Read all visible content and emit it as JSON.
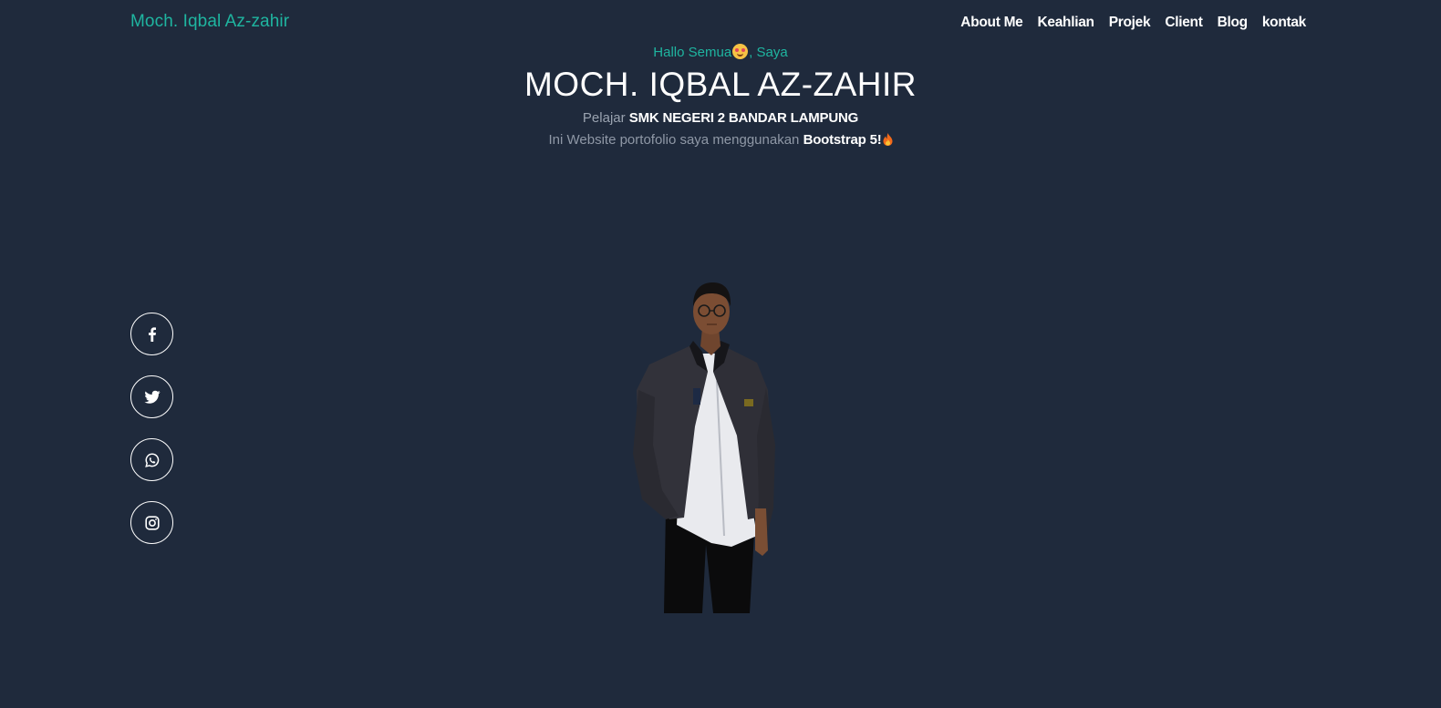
{
  "navbar": {
    "brand": "Moch. Iqbal Az-zahir",
    "links": [
      "About Me",
      "Keahlian",
      "Projek",
      "Client",
      "Blog",
      "kontak"
    ]
  },
  "hero": {
    "greeting_before": "Hallo Semua",
    "greeting_after": ", Saya",
    "name": "MOCH. IQBAL AZ-ZAHIR",
    "line1_prefix": "Pelajar ",
    "line1_school": "SMK NEGERI 2 BANDAR LAMPUNG",
    "line2_prefix": "Ini Website portofolio saya menggunakan ",
    "line2_tech": "Bootstrap 5!"
  },
  "social": [
    {
      "icon": "facebook-icon"
    },
    {
      "icon": "twitter-icon"
    },
    {
      "icon": "whatsapp-icon"
    },
    {
      "icon": "instagram-icon"
    }
  ],
  "colors": {
    "background": "#1f2a3c",
    "accent": "#1fb5a0",
    "text": "#ffffff",
    "muted": "#9aa3b0"
  }
}
